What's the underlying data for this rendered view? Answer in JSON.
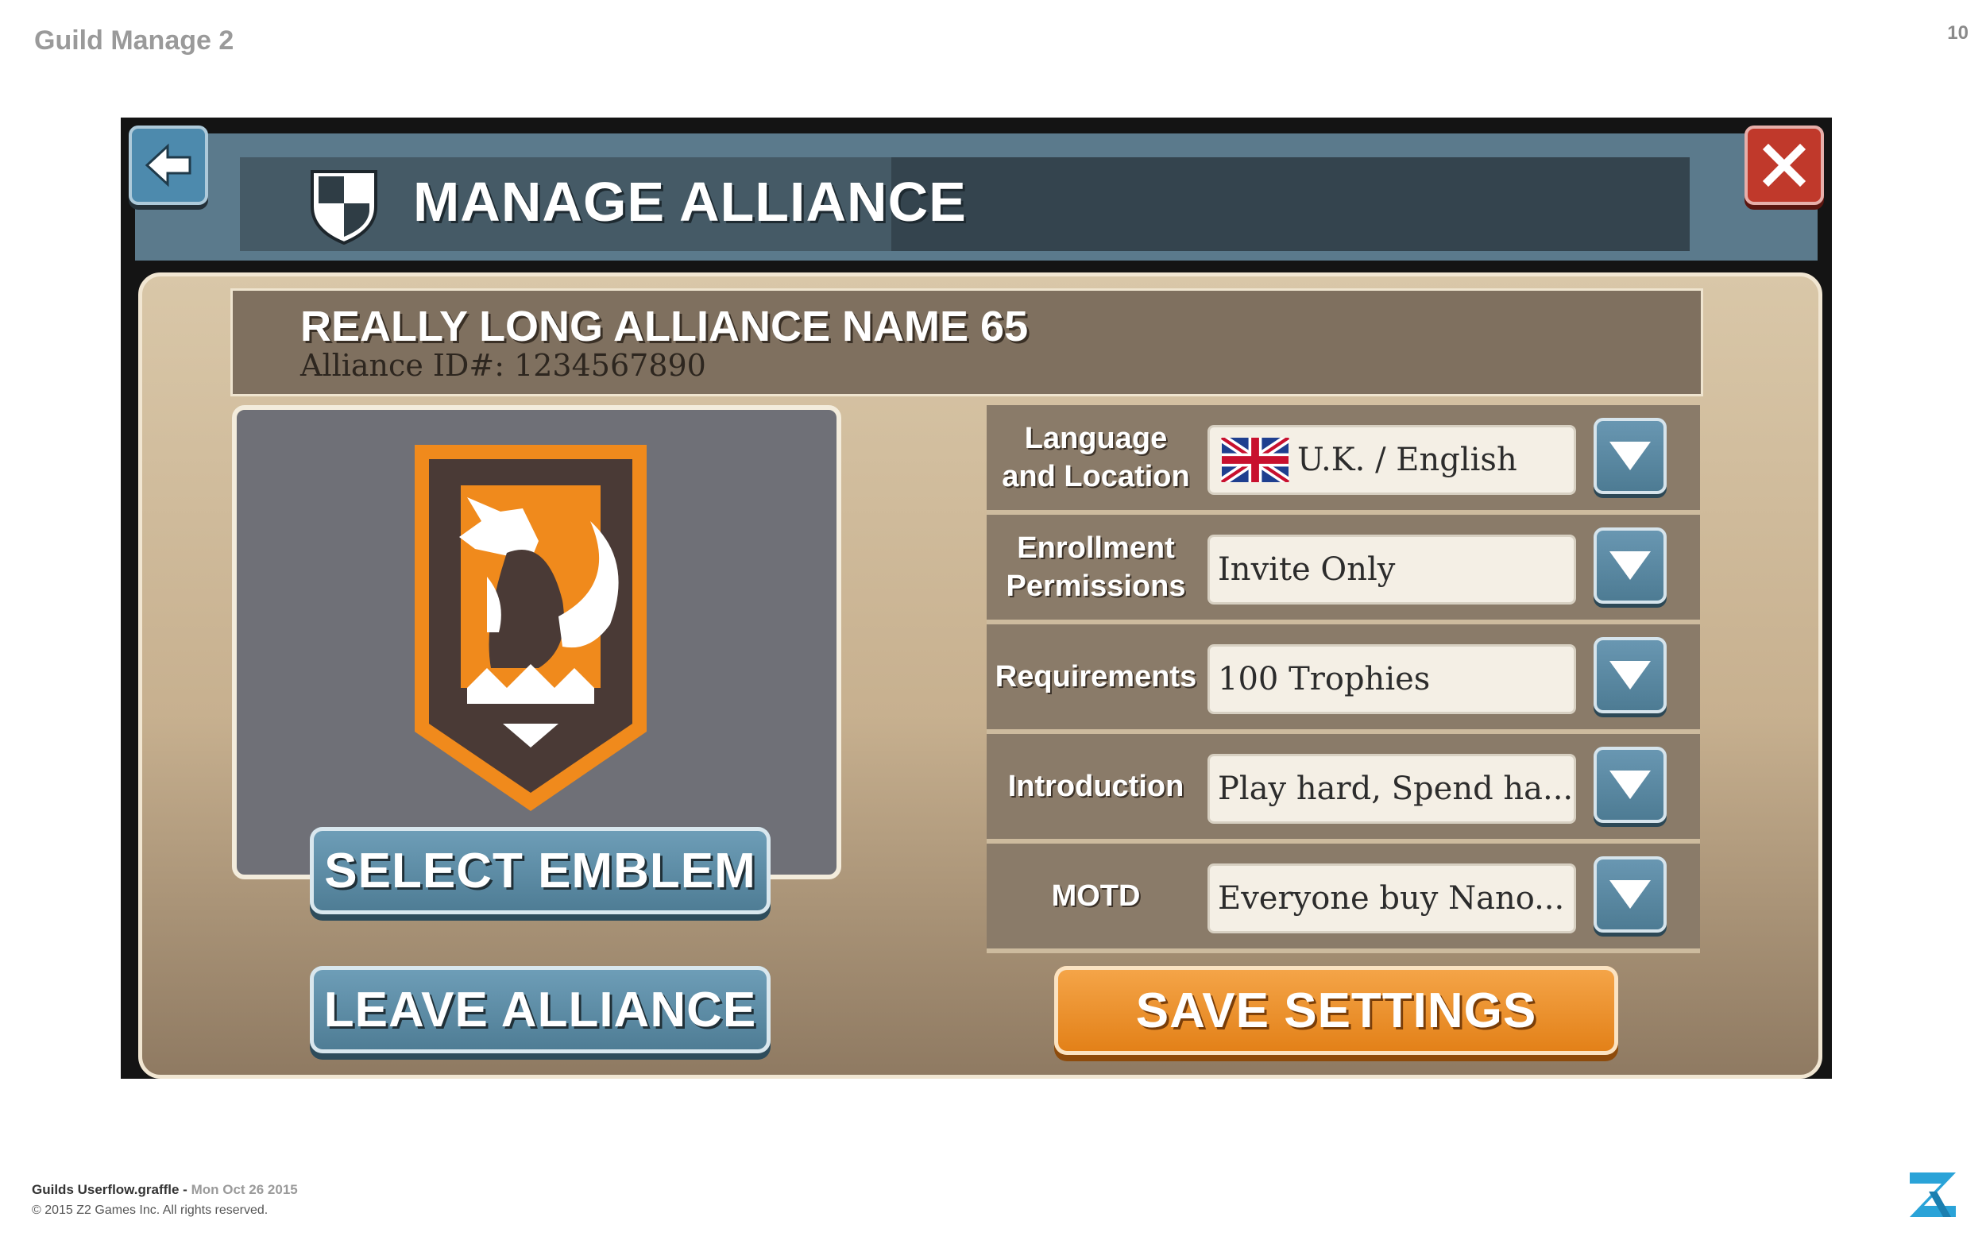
{
  "page": {
    "heading": "Guild Manage 2",
    "number": "10",
    "footer_file": "Guilds Userflow.graffle - ",
    "footer_date": "Mon Oct 26 2015",
    "footer_copyright": "© 2015 Z2 Games Inc. All rights reserved."
  },
  "header": {
    "title": "MANAGE ALLIANCE",
    "back_icon": "back-arrow-icon",
    "close_icon": "close-icon"
  },
  "alliance": {
    "name": "REALLY LONG ALLIANCE NAME 65",
    "id_line": "Alliance ID#: 1234567890"
  },
  "emblem": {
    "select_label": "SELECT EMBLEM",
    "colors": {
      "orange": "#f08a1c",
      "brown": "#4a3a36",
      "white": "#ffffff"
    }
  },
  "actions": {
    "leave_label": "LEAVE ALLIANCE",
    "save_label": "SAVE SETTINGS"
  },
  "settings": {
    "rows": [
      {
        "label_line1": "Language",
        "label_line2": "and Location",
        "value": "U.K. / English",
        "icon": "uk-flag-icon"
      },
      {
        "label_line1": "Enrollment",
        "label_line2": "Permissions",
        "value": "Invite Only"
      },
      {
        "label_line1": "Requirements",
        "label_line2": "",
        "value": "100 Trophies"
      },
      {
        "label_line1": "Introduction",
        "label_line2": "",
        "value": "Play hard, Spend ha..."
      },
      {
        "label_line1": "MOTD",
        "label_line2": "",
        "value": "Everyone buy Nano..."
      }
    ]
  },
  "colors": {
    "header_blue": "#5b7a8c",
    "button_blue": "#4d8aad",
    "close_red": "#c0392b",
    "save_orange": "#e27f16",
    "panel_tan": "#d9c7a8"
  }
}
